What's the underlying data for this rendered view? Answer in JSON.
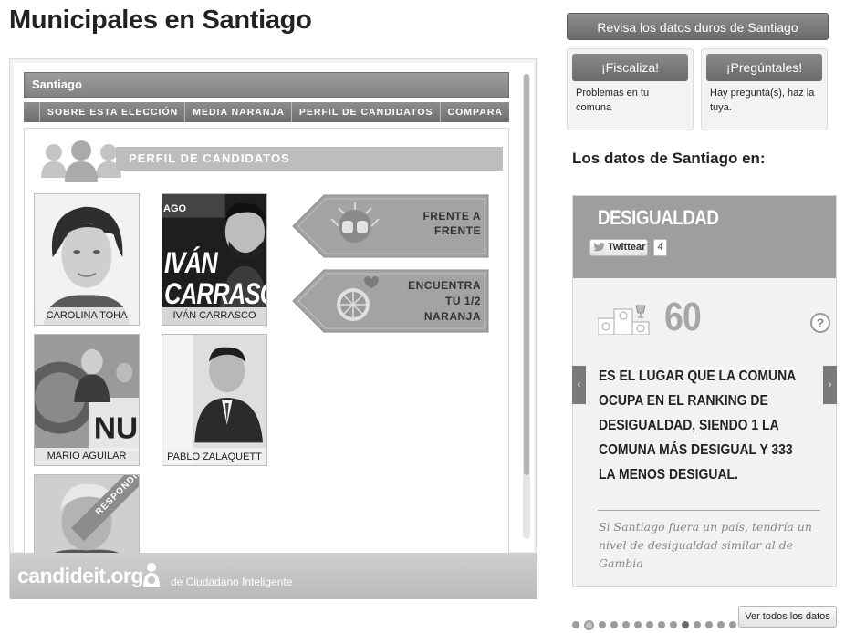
{
  "page": {
    "title": "Municipales en Santiago"
  },
  "widget": {
    "titlebar": "Santiago",
    "nav": [
      "SOBRE ESTA ELECCIÓN",
      "MEDIA NARANJA",
      "PERFIL DE CANDIDATOS",
      "COMPARA"
    ],
    "section_title": "PERFIL DE CANDIDATOS",
    "candidates": [
      {
        "name": "CAROLINA TOHA"
      },
      {
        "name": "IVÁN CARRASCO",
        "poster_text": "IVÁN CARRASCO",
        "poster_corner": "AGO"
      },
      {
        "name": "MARIO AGUILAR"
      },
      {
        "name": "PABLO ZALAQUETT"
      },
      {
        "name": "",
        "badge": "RESPONDIDO"
      }
    ],
    "buttons": {
      "frente_line1": "FRENTE A",
      "frente_line2": "FRENTE",
      "naranja_line1": "ENCUENTRA",
      "naranja_line2": "TU 1/2",
      "naranja_line3": "NARANJA"
    },
    "footer": {
      "brand": "candideit.org",
      "sub": "de Ciudadano Inteligente"
    }
  },
  "sidebar": {
    "datos_duros_button": "Revisa los datos duros de Santiago",
    "fiscaliza": {
      "button": "¡Fiscaliza!",
      "text": "Problemas en tu comuna"
    },
    "preguntales": {
      "button": "¡Pregúntales!",
      "text": "Hay pregunta(s), haz la tuya."
    },
    "heading": "Los datos de Santiago en:",
    "panel": {
      "title": "DESIGUALDAD",
      "tweet_label": "Twittear",
      "tweet_count": "4",
      "rank": "60",
      "help": "?",
      "description": "ES EL LUGAR QUE LA COMUNA OCUPA EN EL RANKING DE DESIGUALDAD, SIENDO 1 LA COMUNA MÁS DESIGUAL Y 333 LA MENOS DESIGUAL.",
      "note": "Si Santiago fuera un país, tendría un nivel de desigualdad similar al de Gambia",
      "prev": "‹",
      "next": "›"
    },
    "pager": {
      "count": 14,
      "active_index": 1,
      "dark_indices": [
        9
      ]
    },
    "ver_todos": "Ver todos los datos"
  }
}
